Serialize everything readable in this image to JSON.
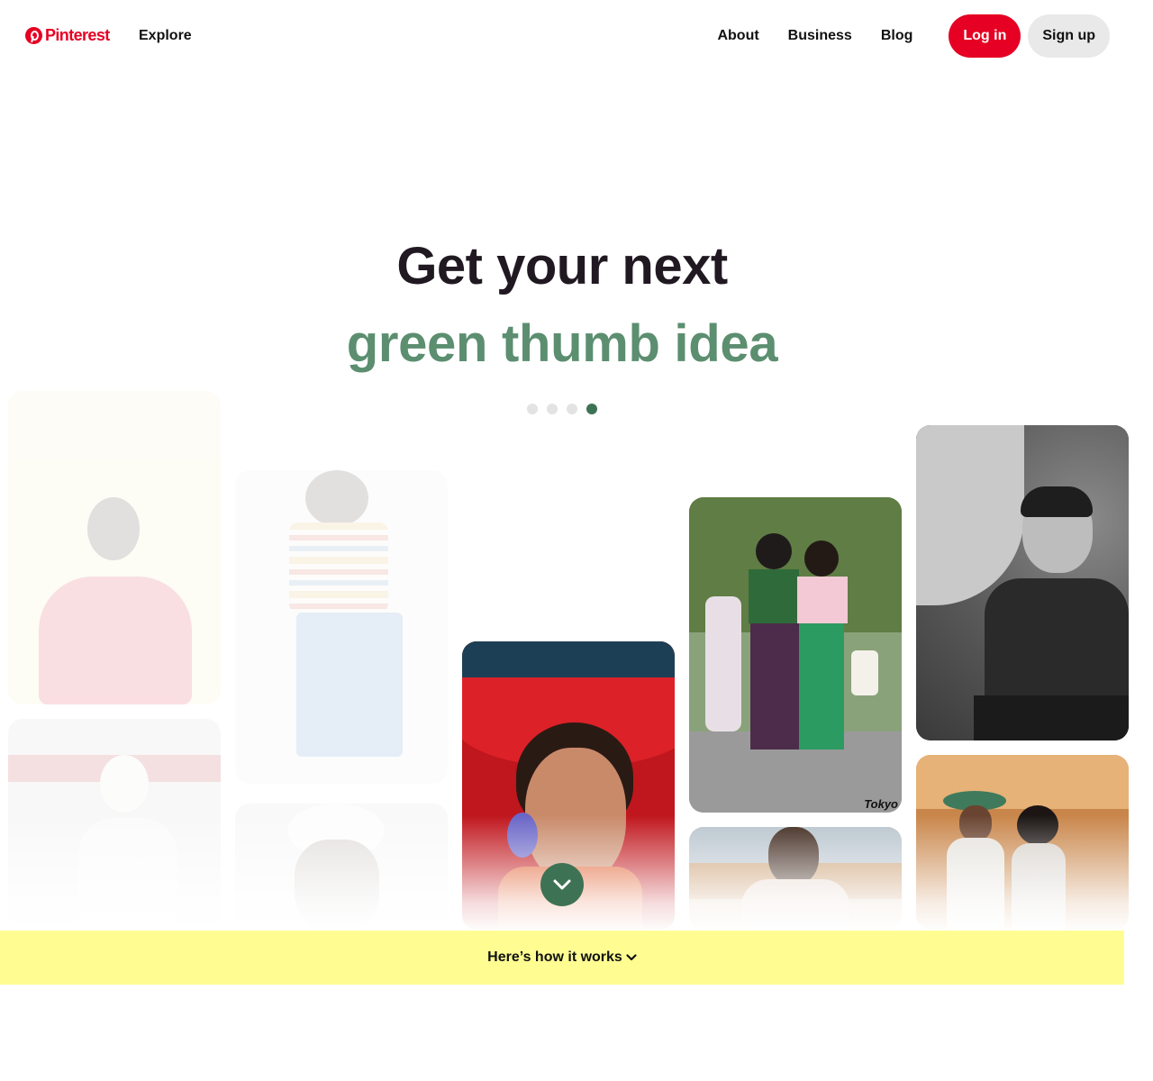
{
  "header": {
    "brand": "Pinterest",
    "explore": "Explore",
    "links": [
      "About",
      "Business",
      "Blog"
    ],
    "login": "Log in",
    "signup": "Sign up"
  },
  "hero": {
    "line1": "Get your next",
    "line2": "green thumb idea",
    "slides_total": 4,
    "active_slide": 4
  },
  "pins": {
    "tokyo_watermark": "Tokyo"
  },
  "how_it_works": "Here’s how it works",
  "colors": {
    "brand_red": "#e60023",
    "accent_green": "#5c8e70",
    "dot_active": "#3e7254",
    "banner_yellow": "#fffd92"
  }
}
